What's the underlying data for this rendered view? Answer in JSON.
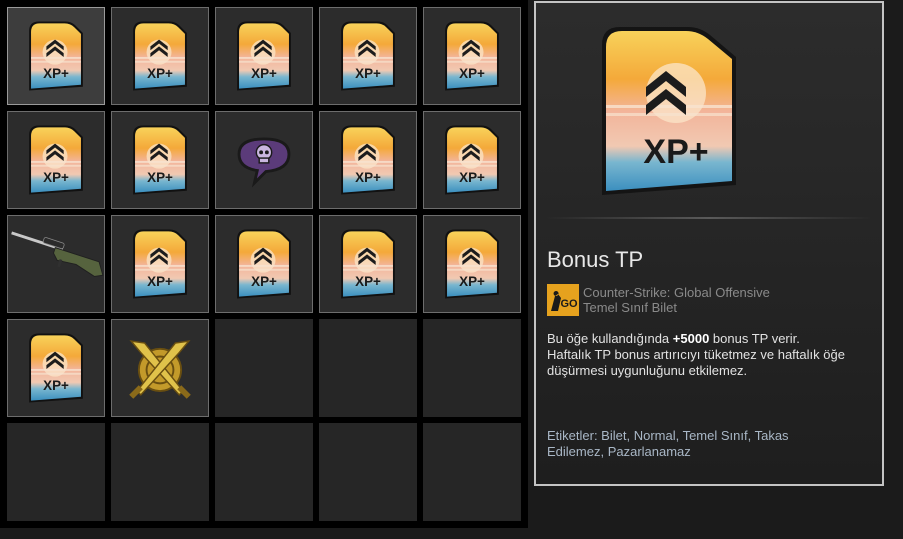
{
  "inventory": {
    "slots": [
      {
        "item": "xp-ticket",
        "selected": true
      },
      {
        "item": "xp-ticket"
      },
      {
        "item": "xp-ticket"
      },
      {
        "item": "xp-ticket"
      },
      {
        "item": "xp-ticket"
      },
      {
        "item": "xp-ticket"
      },
      {
        "item": "xp-ticket"
      },
      {
        "item": "skull-graffiti"
      },
      {
        "item": "xp-ticket"
      },
      {
        "item": "xp-ticket"
      },
      {
        "item": "sniper-rifle"
      },
      {
        "item": "xp-ticket"
      },
      {
        "item": "xp-ticket"
      },
      {
        "item": "xp-ticket"
      },
      {
        "item": "xp-ticket"
      },
      {
        "item": "xp-ticket"
      },
      {
        "item": "gold-crossed-knives-coin"
      },
      {
        "item": ""
      },
      {
        "item": ""
      },
      {
        "item": ""
      },
      {
        "item": ""
      },
      {
        "item": ""
      },
      {
        "item": ""
      },
      {
        "item": ""
      },
      {
        "item": ""
      }
    ],
    "badge_text": "XP+"
  },
  "detail": {
    "name": "Bonus TP",
    "game": "Counter-Strike: Global Offensive",
    "game_icon_text": "GO",
    "type": "Temel Sınıf Bilet",
    "description_before": "Bu öğe kullandığında ",
    "description_bold": "+5000",
    "description_after": " bonus TP verir.",
    "description_line2": "Haftalık TP bonus artırıcıyı tüketmez ve haftalık öğe düşürmesi uygunluğunu etkilemez.",
    "tags": "Etiketler: Bilet, Normal, Temel Sınıf, Takas Edilemez, Pazarlanamaz",
    "image_text": "XP+"
  },
  "colors": {
    "badge_top": "#f6c44a",
    "badge_mid": "#f0a09a",
    "badge_bottom": "#4aa6d8",
    "border_selected": "#c4c4c4",
    "tags_color": "#a9b7c6"
  }
}
